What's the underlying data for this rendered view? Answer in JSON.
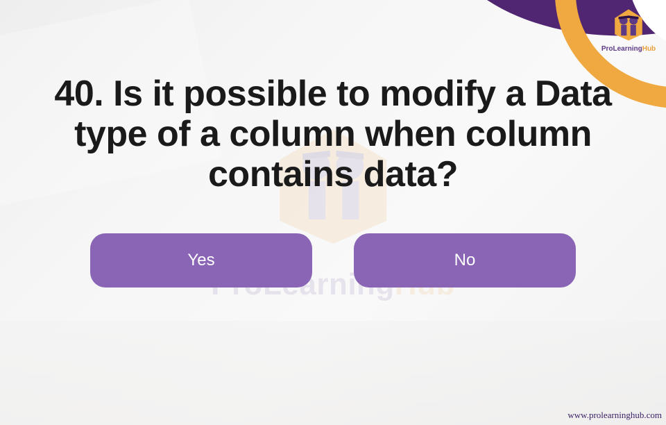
{
  "question": {
    "number": "40",
    "text": "40. Is it possible to modify a Data type of a column when column contains data?"
  },
  "options": [
    {
      "label": "Yes"
    },
    {
      "label": "No"
    }
  ],
  "branding": {
    "watermark_pro": "Pro",
    "watermark_learning": "Learning",
    "watermark_hub": "Hub",
    "small_pro": "ProLearning",
    "small_hub": "Hub"
  },
  "footer": {
    "url": "www.prolearninghub.com"
  },
  "colors": {
    "button_bg": "#8a65b5",
    "brand_purple": "#502572",
    "brand_orange": "#f0a940"
  }
}
